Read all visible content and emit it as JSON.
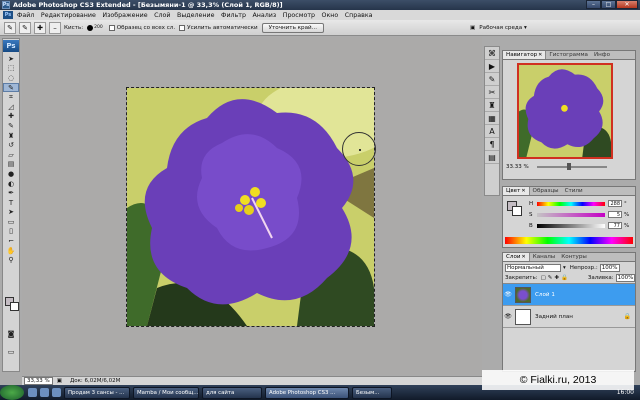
{
  "window": {
    "title": "Adobe Photoshop CS3 Extended - [Безымяни-1 @ 33,3% (Слой 1, RGB/8)]",
    "ps_short": "Ps"
  },
  "menu": {
    "items": [
      "Файл",
      "Редактирование",
      "Изображение",
      "Слой",
      "Выделение",
      "Фильтр",
      "Анализ",
      "Просмотр",
      "Окно",
      "Справка"
    ]
  },
  "options": {
    "brush_label": "Кисть:",
    "brush_size": "200",
    "sample_all": "Образец со всех сл.",
    "auto_enhance": "Усилить автоматически",
    "refine_edge": "Уточнить край...",
    "workspace": "Рабочая среда ▾"
  },
  "status": {
    "zoom": "33,33 %",
    "doc": "Док: 6,02М/6,02М"
  },
  "navigator": {
    "tabs": [
      "Навигатор",
      "Гистограмма",
      "Инфо"
    ],
    "zoom": "33.33 %"
  },
  "color_panel": {
    "tabs": [
      "Цвет",
      "Образцы",
      "Стили"
    ],
    "rows": [
      {
        "ch": "H",
        "value": "288",
        "unit": "°"
      },
      {
        "ch": "S",
        "value": "5",
        "unit": "%"
      },
      {
        "ch": "B",
        "value": "77",
        "unit": "%"
      }
    ]
  },
  "layers_panel": {
    "tabs": [
      "Слои",
      "Каналы",
      "Контуры"
    ],
    "blend_mode": "Нормальный",
    "opacity_label": "Непрозр.:",
    "opacity": "100%",
    "lock_label": "Закрепить:",
    "fill_label": "Заливка:",
    "fill": "100%",
    "layers": [
      {
        "name": "Слой 1",
        "selected": true
      },
      {
        "name": "Задний план",
        "selected": false
      }
    ]
  },
  "taskbar": {
    "items": [
      "Продам 3 сансы - ...",
      "Mamba / Мои сообщ...",
      "для сайта",
      "Adobe Photoshop CS3 ...",
      "Безым..."
    ],
    "clock": "16:00"
  },
  "watermark": "© Fialki.ru, 2013",
  "colors": {
    "selection_blue": "#3d9cef",
    "flower_purple": "#6a3fb8",
    "stamen_yellow": "#f0de22"
  }
}
